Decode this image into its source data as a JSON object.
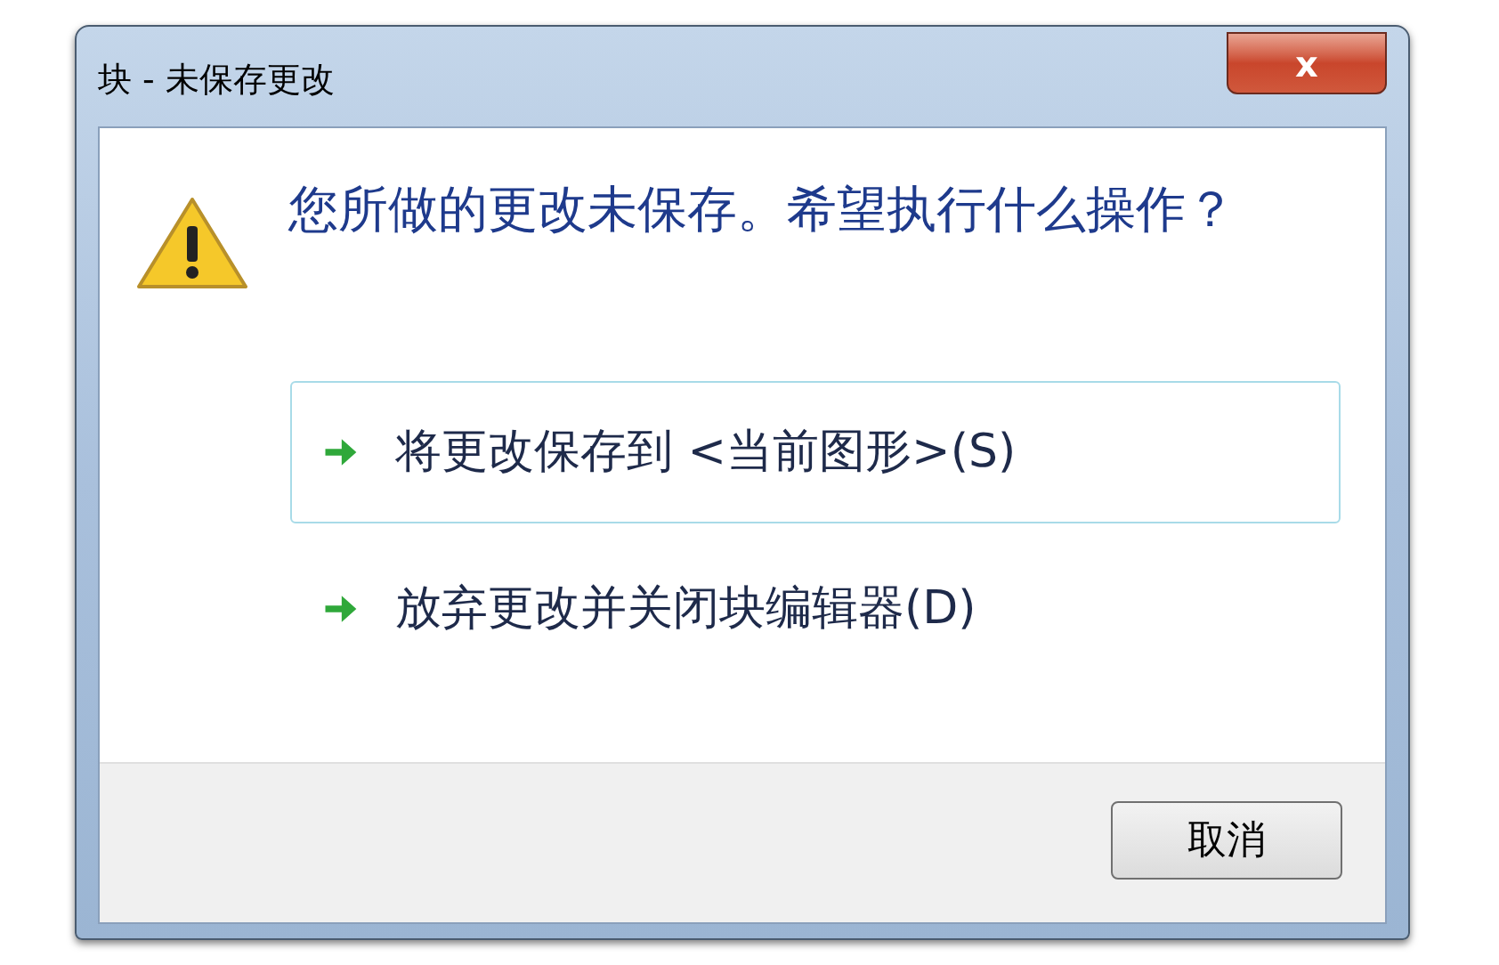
{
  "window": {
    "title": "块 - 未保存更改",
    "close_button": "x"
  },
  "message": "您所做的更改未保存。希望执行什么操作？",
  "options": [
    {
      "label": "将更改保存到 <当前图形>(S)",
      "selected": true
    },
    {
      "label": "放弃更改并关闭块编辑器(D)",
      "selected": false
    }
  ],
  "buttons": [
    {
      "label": "取消"
    }
  ]
}
